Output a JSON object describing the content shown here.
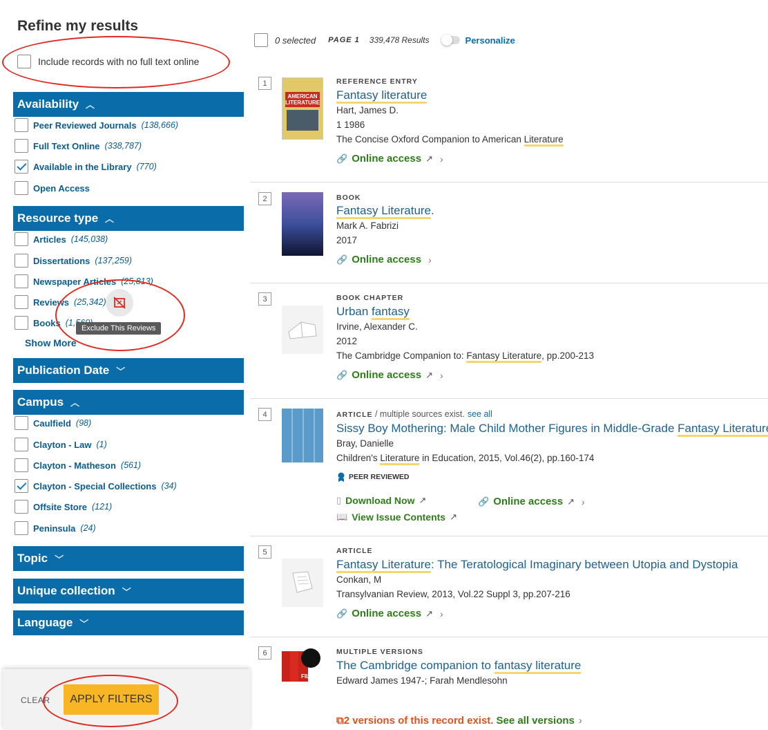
{
  "sidebar": {
    "title": "Refine my results",
    "include_no_fulltext": "Include records with no full text online",
    "availability": {
      "title": "Availability",
      "items": [
        {
          "label": "Peer Reviewed Journals",
          "count": "(138,666)",
          "checked": false
        },
        {
          "label": "Full Text Online",
          "count": "(338,787)",
          "checked": false
        },
        {
          "label": "Available in the Library",
          "count": "(770)",
          "checked": true
        },
        {
          "label": "Open Access",
          "count": "",
          "checked": false
        }
      ]
    },
    "resource_type": {
      "title": "Resource type",
      "items": [
        {
          "label": "Articles",
          "count": "(145,038)"
        },
        {
          "label": "Dissertations",
          "count": "(137,259)"
        },
        {
          "label": "Newspaper Articles",
          "count": "(25,813)"
        },
        {
          "label": "Reviews",
          "count": "(25,342)"
        },
        {
          "label": "Books",
          "count": "(1,560)"
        }
      ],
      "show_more": "Show More"
    },
    "exclude_tooltip": "Exclude This Reviews",
    "publication_date": "Publication Date",
    "campus": {
      "title": "Campus",
      "items": [
        {
          "label": "Caulfield",
          "count": "(98)",
          "checked": false
        },
        {
          "label": "Clayton - Law",
          "count": "(1)",
          "checked": false
        },
        {
          "label": "Clayton - Matheson",
          "count": "(561)",
          "checked": false
        },
        {
          "label": "Clayton - Special Collections",
          "count": "(34)",
          "checked": true
        },
        {
          "label": "Offsite Store",
          "count": "(121)",
          "checked": false
        },
        {
          "label": "Peninsula",
          "count": "(24)",
          "checked": false
        }
      ]
    },
    "topic": "Topic",
    "unique_collection": "Unique collection",
    "language": "Language",
    "clear": "CLEAR",
    "apply": "APPLY FILTERS"
  },
  "results_bar": {
    "selected": "0 selected",
    "page": "PAGE 1",
    "count": "339,478 Results",
    "personalize": "Personalize"
  },
  "results": [
    {
      "num": "1",
      "type": "REFERENCE ENTRY",
      "title": "Fantasy literature",
      "author": "Hart, James D.",
      "date": "1 1986",
      "source_pre": "The Concise Oxford Companion to American ",
      "source_hl": "Literature",
      "access": "Online access",
      "thumb_text": "AMERICAN LITERATURE"
    },
    {
      "num": "2",
      "type": "BOOK",
      "title": "Fantasy Literature",
      "title_post": ".",
      "author": "Mark A. Fabrizi",
      "date": "2017",
      "access": "Online access"
    },
    {
      "num": "3",
      "type": "BOOK CHAPTER",
      "title_pre": "Urban ",
      "title_hl": "fantasy",
      "author": "Irvine, Alexander C.",
      "date": "2012",
      "source_pre": "The Cambridge Companion to: ",
      "source_hl": "Fantasy Literature",
      "source_post": ", pp.200-213",
      "access": "Online access"
    },
    {
      "num": "4",
      "type": "ARTICLE",
      "type_extra": " / multiple sources exist.",
      "see_all": "see all",
      "title_pre": "Sissy Boy Mothering: Male Child Mother Figures in Middle-Grade ",
      "title_hl": "Fantasy Literature",
      "author": "Bray, Danielle",
      "source_pre": "Children's ",
      "source_hl": "Literature",
      "source_post": " in Education, 2015, Vol.46(2), pp.160-174",
      "peer": "PEER REVIEWED",
      "download": "Download Now",
      "issue": "View Issue Contents",
      "access": "Online access"
    },
    {
      "num": "5",
      "type": "ARTICLE",
      "title_hl": "Fantasy Literature",
      "title_post": ": The Teratological Imaginary between Utopia and Dystopia",
      "author": "Conkan, M",
      "source": "Transylvanian Review, 2013, Vol.22 Suppl 3, pp.207-216",
      "access": "Online access"
    },
    {
      "num": "6",
      "type": "MULTIPLE VERSIONS",
      "title_pre": "The Cambridge companion to ",
      "title_hl": "fantasy literature",
      "author": "Edward James 1947-; Farah Mendlesohn",
      "versions": "2 versions of this record exist.",
      "see_versions": "See all versions",
      "thumb_text": "FILM"
    }
  ],
  "colors": {
    "facet_header": "#0a6ca8",
    "link": "#21618e",
    "access_green": "#2e7d1a",
    "highlight": "#f4d56e",
    "apply_button": "#f9b624",
    "annotation_red": "#e02a20"
  }
}
